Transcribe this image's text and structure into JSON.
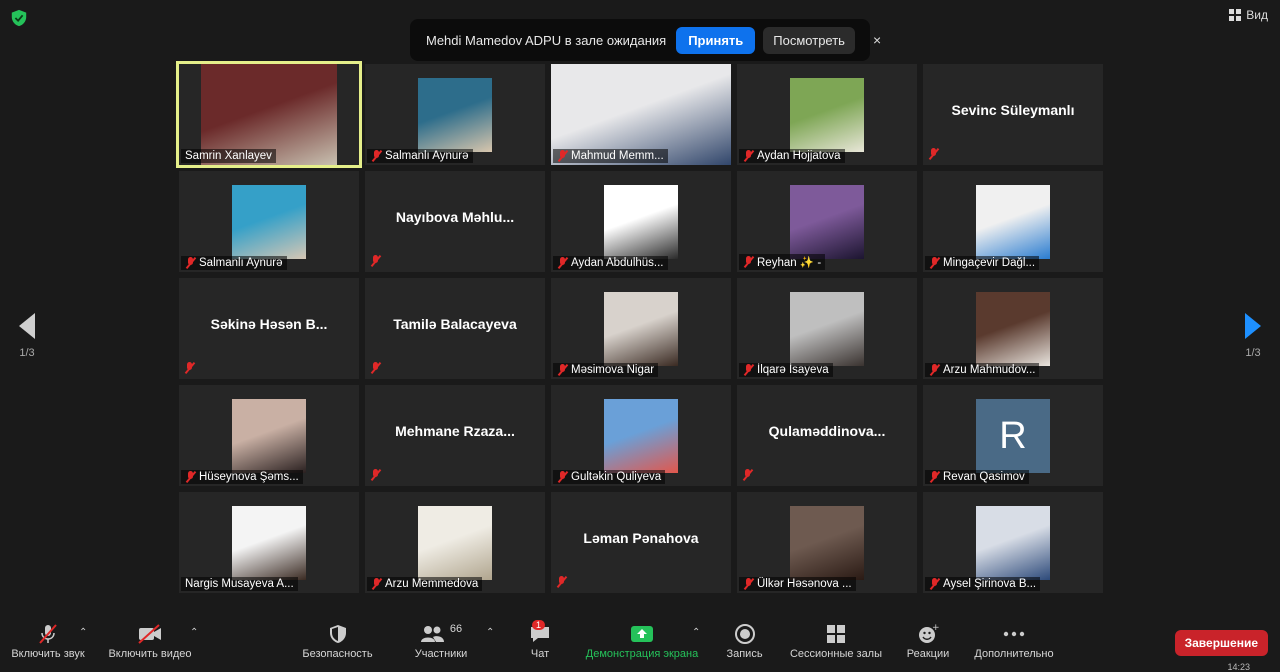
{
  "top": {
    "view_label": "Вид"
  },
  "notice": {
    "message": "Mehdi Mamedov  ADPU в зале ожидания",
    "accept": "Принять",
    "view": "Посмотреть",
    "close": "×"
  },
  "pager": {
    "left": "1/3",
    "right": "1/3"
  },
  "tiles": [
    {
      "name": "Samrin Xanlayev",
      "type": "video",
      "muted": false,
      "active": true,
      "colors": [
        "#6b2a2a",
        "#c8c0b0"
      ]
    },
    {
      "name": "Salmanlı Aynurə",
      "type": "photo",
      "muted": true,
      "colors": [
        "#2d6d8b",
        "#d8c6ad"
      ]
    },
    {
      "name": "Mahmud Memm...",
      "type": "video",
      "muted": true,
      "colors": [
        "#e8e8ea",
        "#31466b"
      ]
    },
    {
      "name": "Aydan Hojjatova",
      "type": "photo",
      "muted": true,
      "colors": [
        "#7ea655",
        "#e8e6d8"
      ]
    },
    {
      "name": "Sevinc Süleymanlı",
      "type": "name",
      "muted": true
    },
    {
      "name": "Salmanlı Aynurə",
      "type": "photo",
      "muted": true,
      "colors": [
        "#35a0c8",
        "#d6c7b5"
      ]
    },
    {
      "name": "Nayıbova  Məhlu...",
      "type": "name",
      "muted": true
    },
    {
      "name": "Aydan Abdulhüs...",
      "type": "photo",
      "muted": true,
      "colors": [
        "#ffffff",
        "#2a2a2a"
      ]
    },
    {
      "name": "Reyhan ✨ -",
      "type": "photo",
      "muted": true,
      "colors": [
        "#7e5a9a",
        "#1c1530"
      ]
    },
    {
      "name": "Mingaçevir Dağl...",
      "type": "photo",
      "muted": true,
      "colors": [
        "#f0f0f0",
        "#2a7cd0"
      ]
    },
    {
      "name": "Səkinə  Həsən  B...",
      "type": "name",
      "muted": true
    },
    {
      "name": "Tamilə Balacayeva",
      "type": "name",
      "muted": true
    },
    {
      "name": "Məsimova Nigar",
      "type": "photo",
      "muted": true,
      "colors": [
        "#d8d2cc",
        "#3a2a22"
      ]
    },
    {
      "name": "İlqarə İsayeva",
      "type": "photo",
      "muted": true,
      "colors": [
        "#bfbfbf",
        "#3a3330"
      ]
    },
    {
      "name": "Arzu Mahmudov...",
      "type": "photo",
      "muted": true,
      "colors": [
        "#5a3a2e",
        "#e9e4de"
      ]
    },
    {
      "name": "Hüseynova Şəms...",
      "type": "photo",
      "muted": true,
      "colors": [
        "#c9b0a4",
        "#2a2020"
      ]
    },
    {
      "name": "Mehmane  Rzaza...",
      "type": "name",
      "muted": true
    },
    {
      "name": "Gultəkin Quliyeva",
      "type": "photo",
      "muted": true,
      "colors": [
        "#6aa0d8",
        "#e2574c"
      ]
    },
    {
      "name": "Qulaməddinova...",
      "type": "name",
      "muted": true
    },
    {
      "name": "Revan Qasimov",
      "type": "avatar",
      "muted": true,
      "initial": "R"
    },
    {
      "name": "Nargis Musayeva A...",
      "type": "photo",
      "muted": false,
      "colors": [
        "#f4f4f4",
        "#3a2a22"
      ]
    },
    {
      "name": "Arzu Memmedova",
      "type": "photo",
      "muted": true,
      "colors": [
        "#efece4",
        "#b0a58e"
      ]
    },
    {
      "name": "Ləman Pənahova",
      "type": "name",
      "muted": true
    },
    {
      "name": "Ülkər Həsənova ...",
      "type": "photo",
      "muted": true,
      "colors": [
        "#6e5a50",
        "#2a1a14"
      ]
    },
    {
      "name": "Aysel Şirinova B...",
      "type": "photo",
      "muted": true,
      "colors": [
        "#d8dde6",
        "#2d4a7a"
      ]
    }
  ],
  "toolbar": {
    "mute": "Включить звук",
    "video": "Включить видео",
    "security": "Безопасность",
    "participants": "Участники",
    "participants_count": "66",
    "chat": "Чат",
    "chat_badge": "1",
    "share": "Демонстрация экрана",
    "record": "Запись",
    "breakout": "Сессионные залы",
    "reactions": "Реакции",
    "more": "Дополнительно",
    "end": "Завершение",
    "clock": "14:23"
  },
  "colors": {
    "accent": "#0e72ed",
    "active_border": "#e5ef8a",
    "danger": "#c9232a",
    "share_green": "#25c25a"
  }
}
